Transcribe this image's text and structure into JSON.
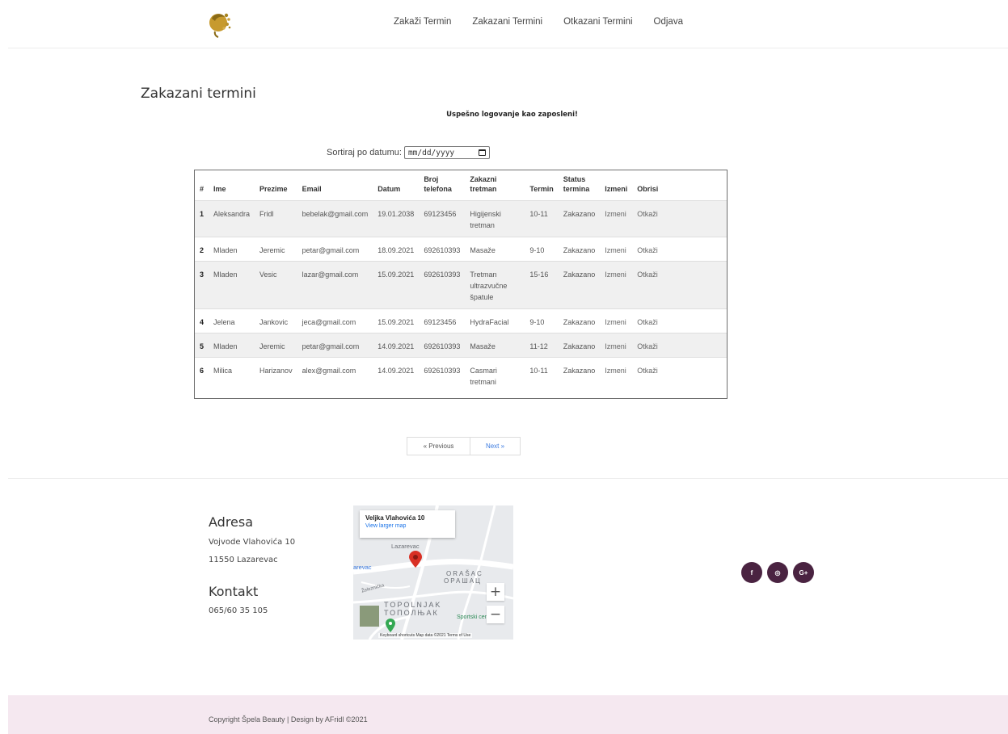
{
  "nav": {
    "items": [
      "Zakaži Termin",
      "Zakazani Termini",
      "Otkazani Termini",
      "Odjava"
    ]
  },
  "page": {
    "title": "Zakazani termini",
    "login_message": "Uspešno logovanje kao zaposleni!",
    "sort_label": "Sortiraj po datumu:",
    "date_placeholder": "mm/dd/yyyy"
  },
  "table": {
    "headers": [
      "#",
      "Ime",
      "Prezime",
      "Email",
      "Datum",
      "Broj telefona",
      "Zakazni tretman",
      "Termin",
      "Status termina",
      "Izmeni",
      "Obrisi"
    ],
    "rows": [
      {
        "num": "1",
        "ime": "Aleksandra",
        "prezime": "Fridl",
        "email": "bebelak@gmail.com",
        "datum": "19.01.2038",
        "telefon": "69123456",
        "tretman": "Higijenski tretman",
        "termin": "10-11",
        "status": "Zakazano",
        "izmeni": "Izmeni",
        "obrisi": "Otkaži"
      },
      {
        "num": "2",
        "ime": "Mladen",
        "prezime": "Jeremic",
        "email": "petar@gmail.com",
        "datum": "18.09.2021",
        "telefon": "692610393",
        "tretman": "Masaže",
        "termin": "9-10",
        "status": "Zakazano",
        "izmeni": "Izmeni",
        "obrisi": "Otkaži"
      },
      {
        "num": "3",
        "ime": "Mladen",
        "prezime": "Vesic",
        "email": "lazar@gmail.com",
        "datum": "15.09.2021",
        "telefon": "692610393",
        "tretman": "Tretman ultrazvučne špatule",
        "termin": "15-16",
        "status": "Zakazano",
        "izmeni": "Izmeni",
        "obrisi": "Otkaži"
      },
      {
        "num": "4",
        "ime": "Jelena",
        "prezime": "Jankovic",
        "email": "jeca@gmail.com",
        "datum": "15.09.2021",
        "telefon": "69123456",
        "tretman": "HydraFacial",
        "termin": "9-10",
        "status": "Zakazano",
        "izmeni": "Izmeni",
        "obrisi": "Otkaži"
      },
      {
        "num": "5",
        "ime": "Mladen",
        "prezime": "Jeremic",
        "email": "petar@gmail.com",
        "datum": "14.09.2021",
        "telefon": "692610393",
        "tretman": "Masaže",
        "termin": "11-12",
        "status": "Zakazano",
        "izmeni": "Izmeni",
        "obrisi": "Otkaži"
      },
      {
        "num": "6",
        "ime": "Milica",
        "prezime": "Harizanov",
        "email": "alex@gmail.com",
        "datum": "14.09.2021",
        "telefon": "692610393",
        "tretman": "Casmari tretmani",
        "termin": "10-11",
        "status": "Zakazano",
        "izmeni": "Izmeni",
        "obrisi": "Otkaži"
      }
    ]
  },
  "pagination": {
    "prev": "« Previous",
    "next": "Next »"
  },
  "footer": {
    "address_heading": "Adresa",
    "address_line1": "Vojvode Vlahovića 10",
    "address_line2": "11550 Lazarevac",
    "contact_heading": "Kontakt",
    "phone": "065/60 35 105",
    "copyright": "Copyright Špela Beauty | Design by AFridl ©2021",
    "social": [
      "f",
      "◎",
      "G+"
    ]
  },
  "map": {
    "place_title": "Veljka Vlahovića 10",
    "larger_map_link": "View larger map",
    "labels": [
      "Lazarevac",
      "ORAŠAC",
      "ОРАШАЦ",
      "TOPOLNJAK",
      "ТОПОЛЊАК",
      "Železnička",
      "arevac",
      "Sportski centar"
    ],
    "footer_text": "Keyboard shortcuts   Map data ©2021   Terms of Use",
    "zoom_in": "+",
    "zoom_out": "−"
  },
  "colors": {
    "accent": "#4a2341",
    "footer_bg": "#f5e8f0",
    "link_blue": "#3c7be0"
  }
}
